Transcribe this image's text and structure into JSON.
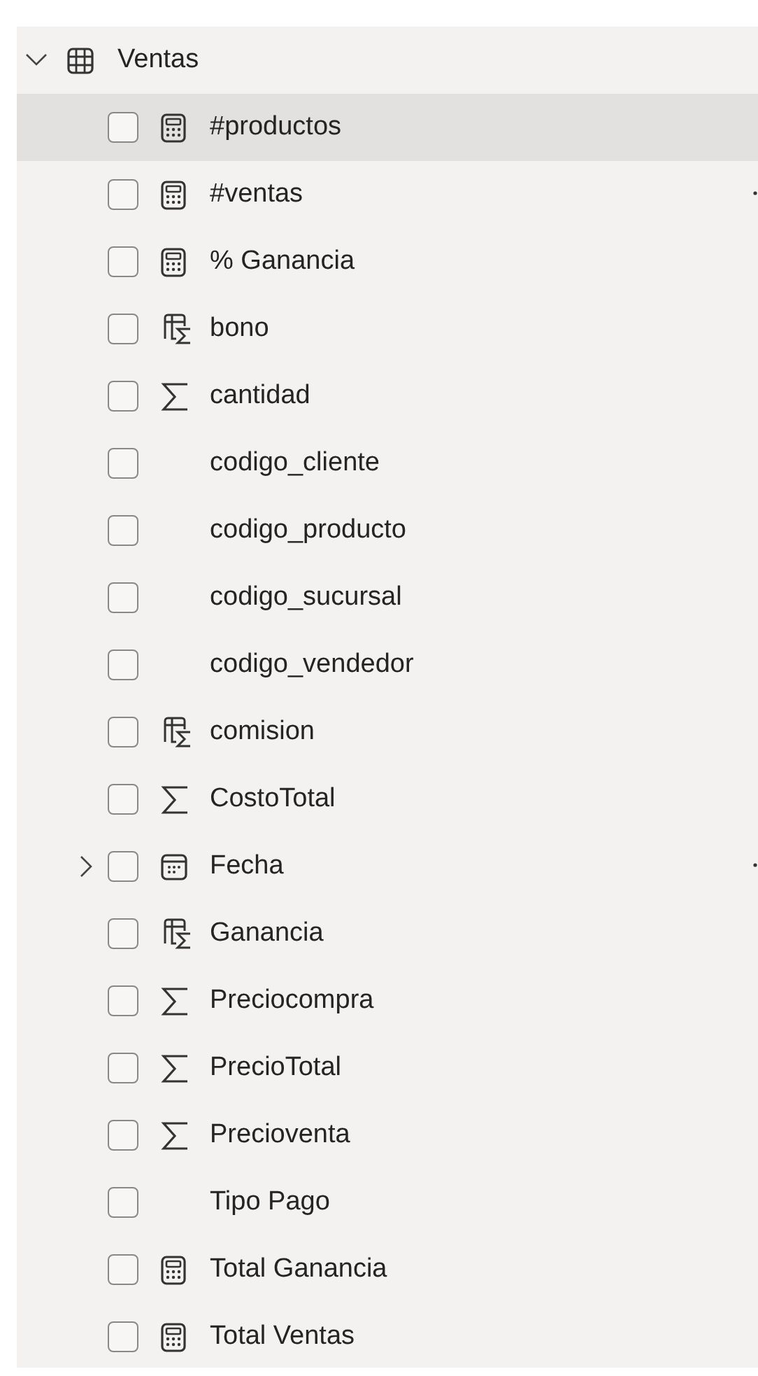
{
  "table": {
    "name": "Ventas",
    "expanded": true
  },
  "fields": [
    {
      "kind": "measure",
      "label": "#productos",
      "checked": false,
      "highlighted": true,
      "show_more": false
    },
    {
      "kind": "measure",
      "label": "#ventas",
      "checked": false,
      "highlighted": false,
      "show_more": true
    },
    {
      "kind": "measure",
      "label": "% Ganancia",
      "checked": false,
      "highlighted": false,
      "show_more": false
    },
    {
      "kind": "calc_column",
      "label": "bono",
      "checked": false,
      "highlighted": false,
      "show_more": false
    },
    {
      "kind": "sum",
      "label": "cantidad",
      "checked": false,
      "highlighted": false,
      "show_more": false
    },
    {
      "kind": "plain",
      "label": "codigo_cliente",
      "checked": false,
      "highlighted": false,
      "show_more": false
    },
    {
      "kind": "plain",
      "label": "codigo_producto",
      "checked": false,
      "highlighted": false,
      "show_more": false
    },
    {
      "kind": "plain",
      "label": "codigo_sucursal",
      "checked": false,
      "highlighted": false,
      "show_more": false
    },
    {
      "kind": "plain",
      "label": "codigo_vendedor",
      "checked": false,
      "highlighted": false,
      "show_more": false
    },
    {
      "kind": "calc_column",
      "label": "comision",
      "checked": false,
      "highlighted": false,
      "show_more": false
    },
    {
      "kind": "sum",
      "label": "CostoTotal",
      "checked": false,
      "highlighted": false,
      "show_more": false
    },
    {
      "kind": "date",
      "label": "Fecha",
      "checked": false,
      "highlighted": false,
      "show_more": true
    },
    {
      "kind": "calc_column",
      "label": "Ganancia",
      "checked": false,
      "highlighted": false,
      "show_more": false
    },
    {
      "kind": "sum",
      "label": "Preciocompra",
      "checked": false,
      "highlighted": false,
      "show_more": false
    },
    {
      "kind": "sum",
      "label": "PrecioTotal",
      "checked": false,
      "highlighted": false,
      "show_more": false
    },
    {
      "kind": "sum",
      "label": "Precioventa",
      "checked": false,
      "highlighted": false,
      "show_more": false
    },
    {
      "kind": "plain",
      "label": "Tipo Pago",
      "checked": false,
      "highlighted": false,
      "show_more": false
    },
    {
      "kind": "measure",
      "label": "Total Ganancia",
      "checked": false,
      "highlighted": false,
      "show_more": false
    },
    {
      "kind": "measure",
      "label": "Total Ventas",
      "checked": false,
      "highlighted": false,
      "show_more": false
    }
  ]
}
